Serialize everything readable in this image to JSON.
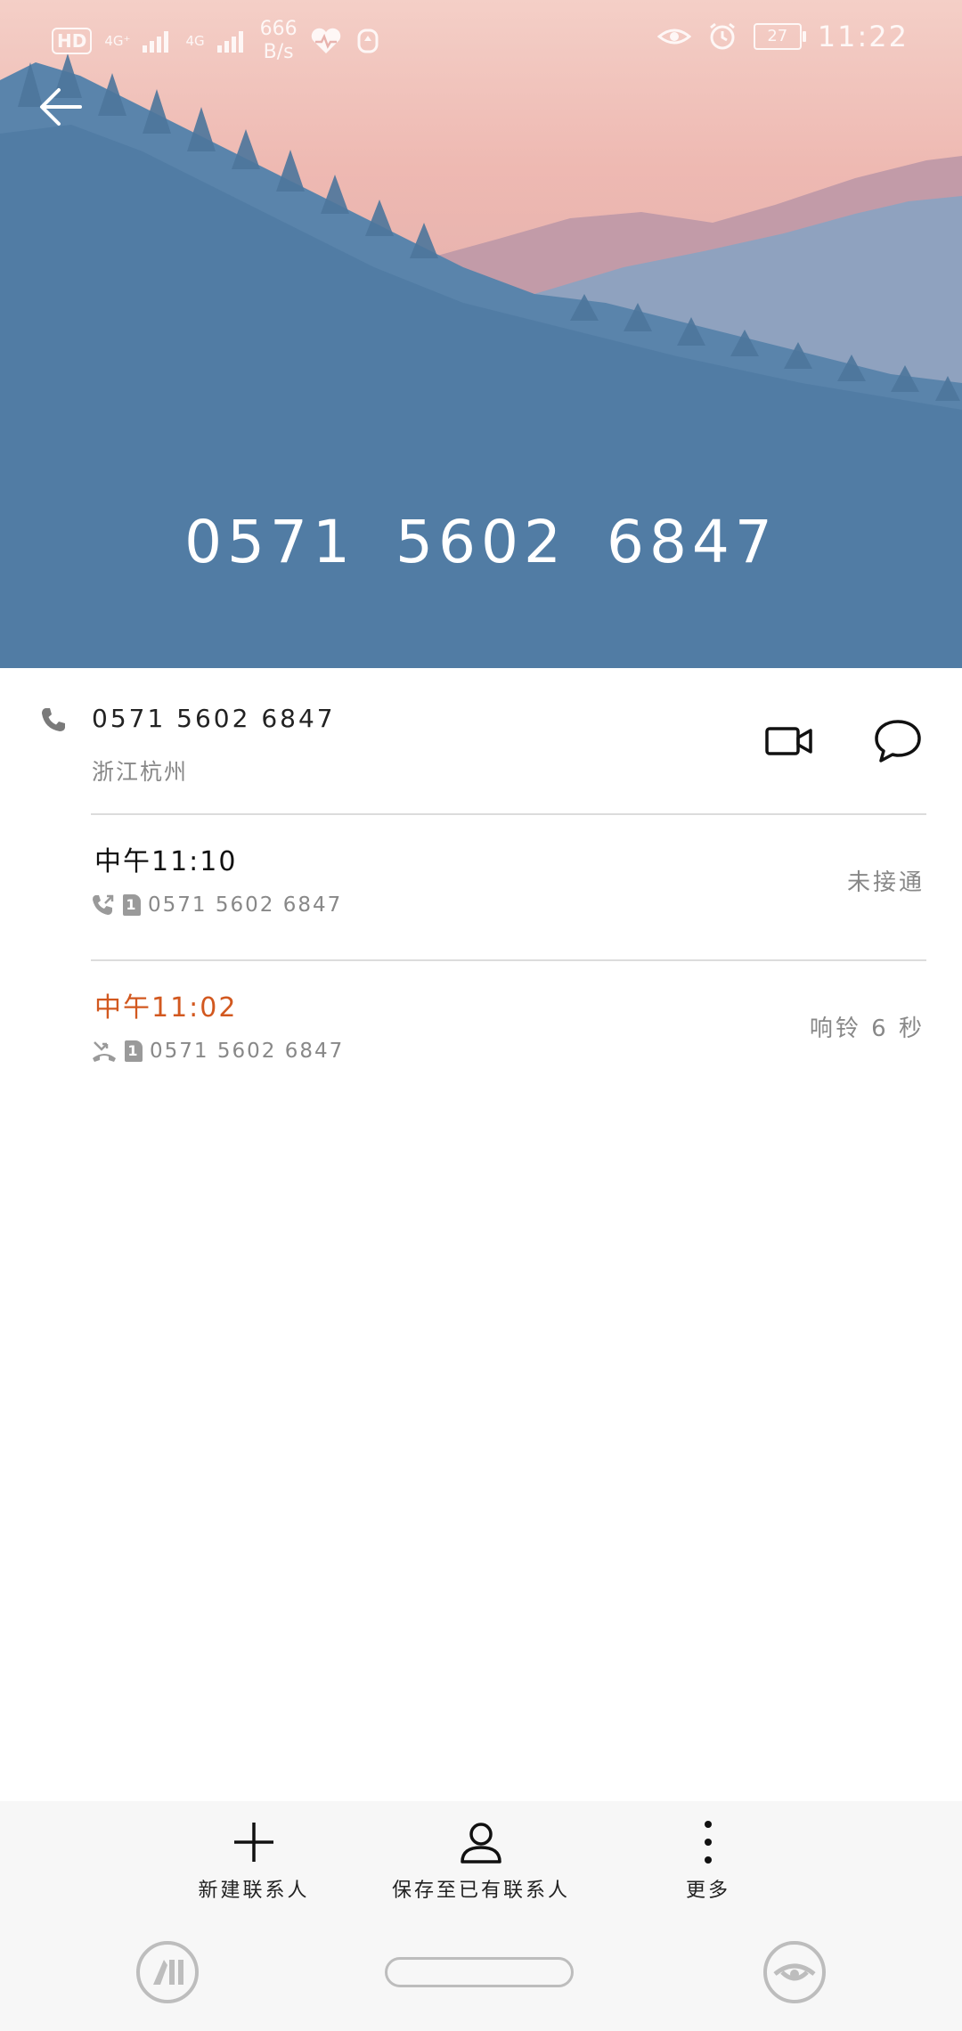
{
  "status_bar": {
    "hd": "HD",
    "net1": "4G⁺",
    "net2": "4G",
    "speed_value": "666",
    "speed_unit": "B/s",
    "battery": "27",
    "time": "11:22"
  },
  "header": {
    "number": "0571 5602 6847"
  },
  "contact": {
    "number": "0571 5602 6847",
    "location": "浙江杭州"
  },
  "calls": [
    {
      "time": "中午11:10",
      "number": "0571 5602 6847",
      "sim": "1",
      "status": "未接通",
      "type": "outgoing"
    },
    {
      "time": "中午11:02",
      "number": "0571 5602 6847",
      "sim": "1",
      "status": "响铃 6 秒",
      "type": "missed"
    }
  ],
  "toolbar": {
    "new_contact": "新建联系人",
    "save_existing": "保存至已有联系人",
    "more": "更多"
  },
  "colors": {
    "missed": "#d2581f",
    "secondary_text": "#888888"
  }
}
